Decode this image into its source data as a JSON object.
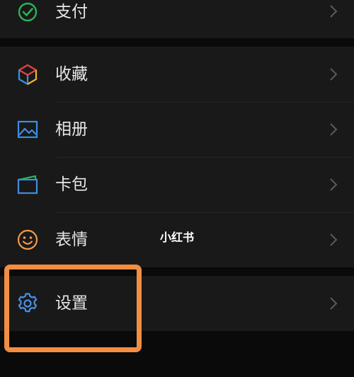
{
  "menu": {
    "items": [
      {
        "label": "支付",
        "icon": "wechat-pay-icon"
      },
      {
        "label": "收藏",
        "icon": "favorites-cube-icon"
      },
      {
        "label": "相册",
        "icon": "album-picture-icon"
      },
      {
        "label": "卡包",
        "icon": "card-wallet-icon"
      },
      {
        "label": "表情",
        "icon": "smiley-face-icon"
      },
      {
        "label": "设置",
        "icon": "gear-icon"
      }
    ]
  },
  "watermark": "小红书",
  "colors": {
    "background": "#0a0a0a",
    "row_background": "#191919",
    "text": "#e6e6e6",
    "chevron": "#5a5a5a",
    "highlight": "#f08f44",
    "pay_green": "#2bb35a",
    "settings_blue": "#4a90e2",
    "smiley_orange": "#f2994a"
  }
}
